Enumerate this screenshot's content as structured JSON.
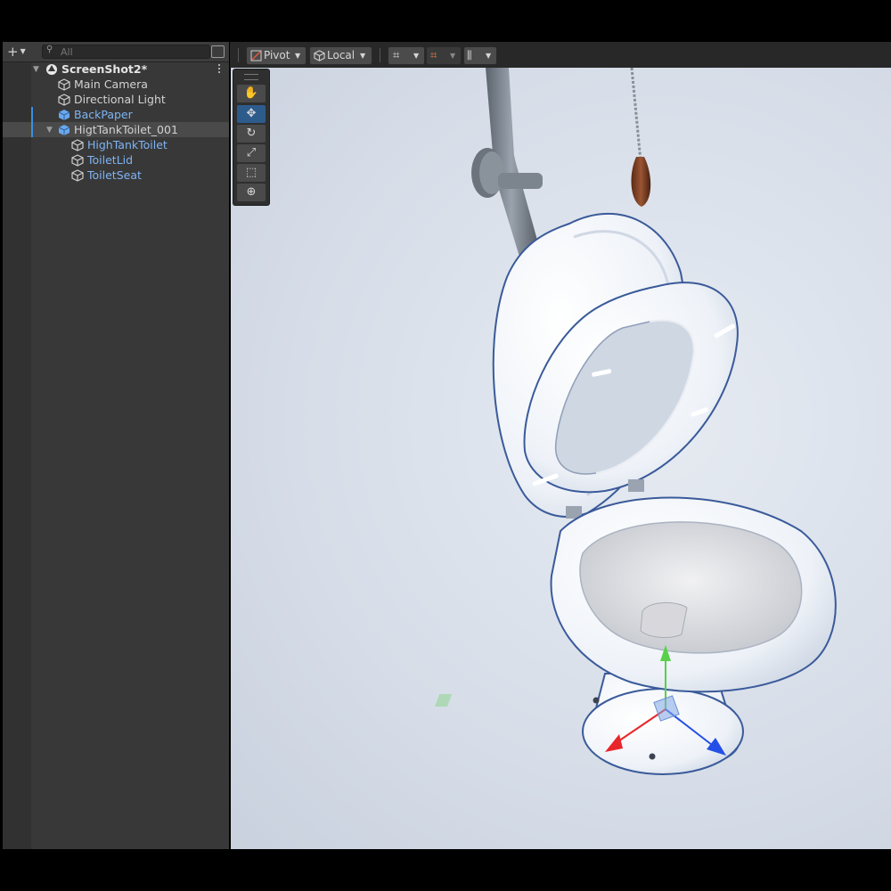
{
  "hierarchy": {
    "search_placeholder": "All",
    "scene_name": "ScreenShot2*",
    "items": [
      {
        "label": "Main Camera"
      },
      {
        "label": "Directional Light"
      },
      {
        "label": "BackPaper"
      },
      {
        "label": "HigtTankToilet_001"
      },
      {
        "label": "HighTankToilet"
      },
      {
        "label": "ToiletLid"
      },
      {
        "label": "ToiletSeat"
      }
    ]
  },
  "scene_toolbar": {
    "pivot_label": "Pivot",
    "local_label": "Local"
  },
  "tools": [
    "hand-tool",
    "move-tool",
    "rotate-tool",
    "scale-tool",
    "rect-tool",
    "transform-tool"
  ],
  "colors": {
    "prefab_text": "#7fb4f2",
    "selection_accent": "#3b8fe0",
    "gizmo_x": "#e8262b",
    "gizmo_y": "#58d04a",
    "gizmo_z": "#2450e8"
  }
}
